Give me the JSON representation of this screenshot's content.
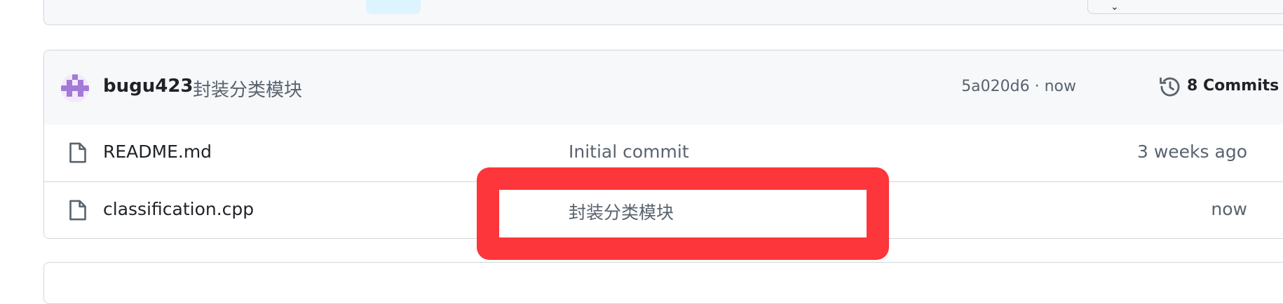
{
  "top_bar": {
    "button_icon": "chevron-icon"
  },
  "latest_commit": {
    "author": "bugu423",
    "message": "封装分类模块",
    "hash_time": "5a020d6 · now",
    "commits_label": "8 Commits",
    "history_icon": "history-icon",
    "avatar_color": "#a37ad6"
  },
  "files": [
    {
      "name": "README.md",
      "commit_message": "Initial commit",
      "age": "3 weeks ago",
      "icon": "file-icon"
    },
    {
      "name": "classification.cpp",
      "commit_message": "封装分类模块",
      "age": "now",
      "icon": "file-icon"
    }
  ],
  "colors": {
    "highlight": "#fc363a",
    "border": "#d0d7de",
    "header_bg": "#f6f8fa",
    "muted_text": "#59636e"
  }
}
